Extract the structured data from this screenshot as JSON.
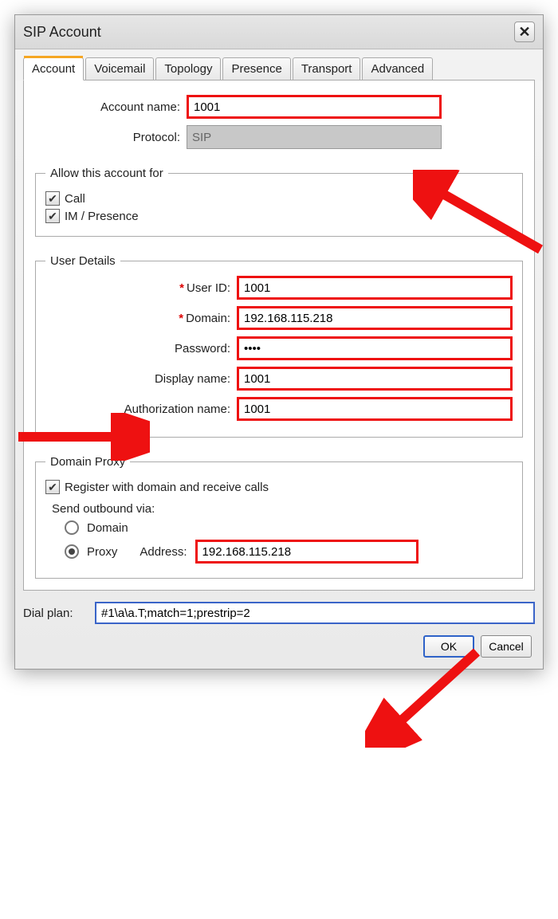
{
  "window": {
    "title": "SIP Account"
  },
  "tabs": [
    "Account",
    "Voicemail",
    "Topology",
    "Presence",
    "Transport",
    "Advanced"
  ],
  "activeTab": 0,
  "account": {
    "name_label": "Account name:",
    "name_value": "1001",
    "protocol_label": "Protocol:",
    "protocol_value": "SIP"
  },
  "allow": {
    "legend": "Allow this account for",
    "call": "Call",
    "im": "IM / Presence"
  },
  "user": {
    "legend": "User Details",
    "userid_label": "User ID:",
    "userid_value": "1001",
    "domain_label": "Domain:",
    "domain_value": "192.168.115.218",
    "password_label": "Password:",
    "password_value": "••••",
    "display_label": "Display name:",
    "display_value": "1001",
    "auth_label": "Authorization name:",
    "auth_value": "1001"
  },
  "proxy": {
    "legend": "Domain Proxy",
    "register": "Register with domain and receive calls",
    "send_label": "Send outbound via:",
    "opt_domain": "Domain",
    "opt_proxy": "Proxy",
    "address_label": "Address:",
    "address_value": "192.168.115.218"
  },
  "dial": {
    "label": "Dial plan:",
    "value": "#1\\a\\a.T;match=1;prestrip=2"
  },
  "buttons": {
    "ok": "OK",
    "cancel": "Cancel"
  }
}
